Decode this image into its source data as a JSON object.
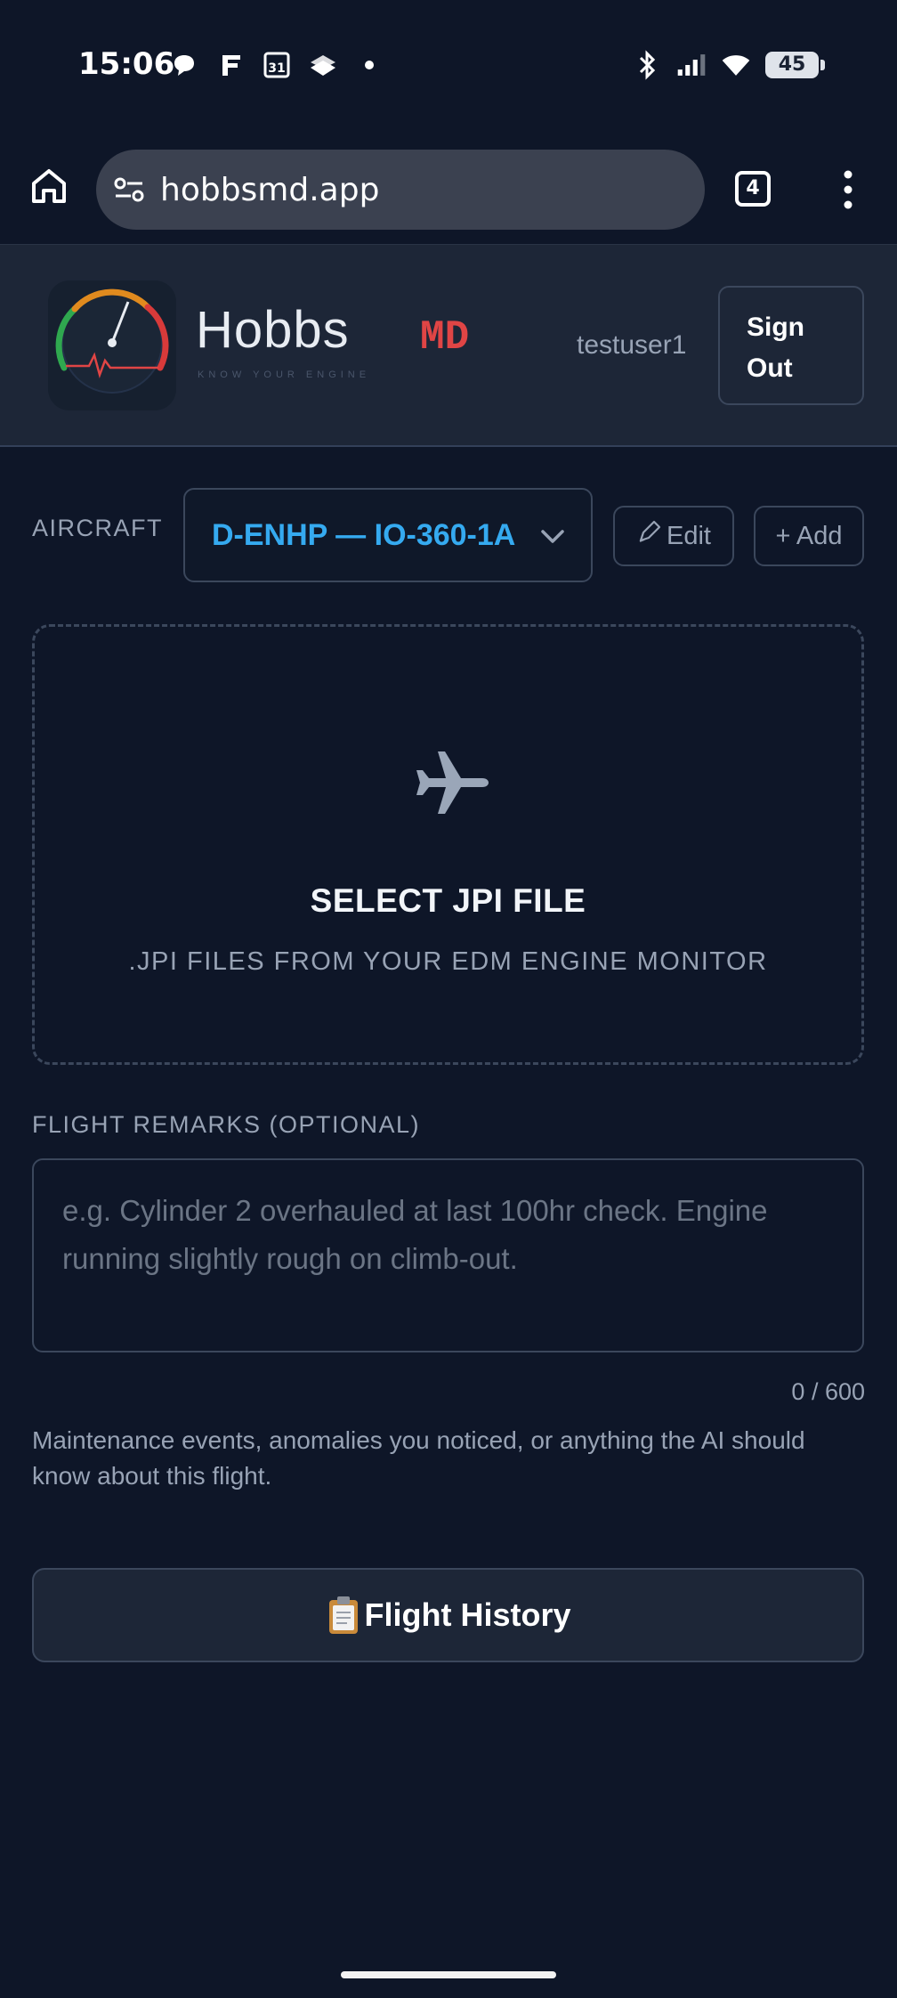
{
  "status_bar": {
    "time": "15:06",
    "battery": "45",
    "icons_left": [
      "chat-bubble-icon",
      "f-app-icon",
      "calendar-31-icon",
      "stack-app-icon",
      "dot-icon"
    ],
    "icons_right": [
      "bluetooth-icon",
      "cellular-signal-icon",
      "wifi-icon",
      "battery-icon"
    ],
    "calendar_day": "31"
  },
  "browser": {
    "url": "hobbsmd.app",
    "tab_count": "4"
  },
  "header": {
    "brand_name": "Hobbs",
    "brand_tagline": "KNOW YOUR ENGINE",
    "brand_suffix": "MD",
    "username": "testuser1",
    "sign_out_label": "Sign Out"
  },
  "aircraft": {
    "label": "AIRCRAFT",
    "selected": "D-ENHP — IO-360-1A",
    "edit_label": "Edit",
    "add_label": "+ Add"
  },
  "upload": {
    "title": "SELECT JPI FILE",
    "subtitle": ".JPI FILES FROM YOUR EDM ENGINE MONITOR"
  },
  "remarks": {
    "label": "FLIGHT REMARKS (OPTIONAL)",
    "placeholder": "e.g. Cylinder 2 overhauled at last 100hr check. Engine running slightly rough on climb-out.",
    "value": "",
    "char_count": "0 / 600",
    "help": "Maintenance events, anomalies you noticed, or anything the AI should know about this flight."
  },
  "history": {
    "label": "Flight History"
  },
  "colors": {
    "background": "#0e1628",
    "header_bg": "#1d2637",
    "accent_blue": "#35aaf0",
    "brand_red": "#e04545",
    "muted_text": "#98a3b5",
    "border": "#3b475c"
  }
}
